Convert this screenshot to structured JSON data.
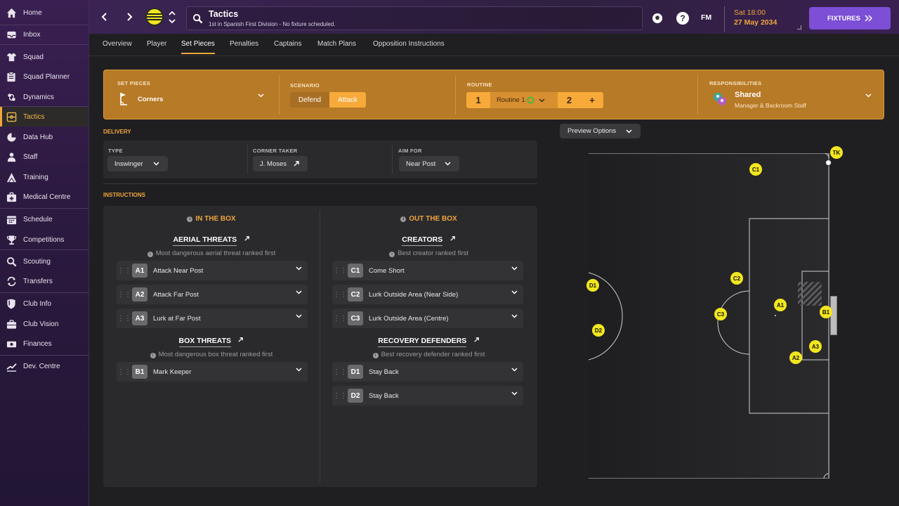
{
  "nav": {
    "items": [
      {
        "label": "Home",
        "icon": "home-icon"
      },
      {
        "label": "Inbox",
        "icon": "inbox-icon"
      },
      {
        "label": "Squad",
        "icon": "squad-icon"
      },
      {
        "label": "Squad Planner",
        "icon": "clipboard-icon"
      },
      {
        "label": "Dynamics",
        "icon": "dynamics-icon"
      },
      {
        "label": "Tactics",
        "icon": "tactics-icon"
      },
      {
        "label": "Data Hub",
        "icon": "data-hub-icon"
      },
      {
        "label": "Staff",
        "icon": "staff-icon"
      },
      {
        "label": "Training",
        "icon": "training-icon"
      },
      {
        "label": "Medical Centre",
        "icon": "medical-icon"
      },
      {
        "label": "Schedule",
        "icon": "calendar-icon"
      },
      {
        "label": "Competitions",
        "icon": "trophy-icon"
      },
      {
        "label": "Scouting",
        "icon": "search-icon"
      },
      {
        "label": "Transfers",
        "icon": "transfer-icon"
      },
      {
        "label": "Club Info",
        "icon": "shield-icon"
      },
      {
        "label": "Club Vision",
        "icon": "briefcase-icon"
      },
      {
        "label": "Finances",
        "icon": "money-icon"
      },
      {
        "label": "Dev. Centre",
        "icon": "growth-icon"
      }
    ]
  },
  "header": {
    "title": "Tactics",
    "subtitle": "1st in Spanish First Division - No fixture scheduled.",
    "date_time": "Sat 18:00",
    "date": "27 May 2034",
    "fm_label": "FM",
    "fixtures_label": "FIXTURES"
  },
  "tabs": [
    "Overview",
    "Player",
    "Set Pieces",
    "Penalties",
    "Captains",
    "Match Plans",
    "Opposition Instructions"
  ],
  "setpieces": {
    "set_pieces_label": "SET PIECES",
    "set_piece_value": "Corners",
    "scenario_label": "SCENARIO",
    "defend": "Defend",
    "attack": "Attack",
    "routine_label": "ROUTINE",
    "routine_num_1": "1",
    "routine_name": "Routine 1",
    "routine_num_2": "2",
    "routine_add": "+",
    "responsibilities_label": "RESPONSIBILITIES",
    "resp_value": "Shared",
    "resp_sub": "Manager & Backroom Staff"
  },
  "delivery": {
    "heading": "DELIVERY",
    "type_label": "TYPE",
    "type_value": "Inswinger",
    "taker_label": "CORNER TAKER",
    "taker_value": "J. Moses",
    "aim_label": "AIM FOR",
    "aim_value": "Near Post"
  },
  "instructions": {
    "heading": "INSTRUCTIONS",
    "in_box": "IN THE BOX",
    "out_box": "OUT THE BOX",
    "aerial_title": "AERIAL THREATS",
    "aerial_sub": "Most dangerous aerial threat ranked first",
    "box_title": "BOX THREATS",
    "box_sub": "Most dangerous box threat ranked first",
    "creators_title": "CREATORS",
    "creators_sub": "Best creator ranked first",
    "recovery_title": "RECOVERY DEFENDERS",
    "recovery_sub": "Best recovery defender ranked first",
    "aerial": [
      {
        "code": "A1",
        "label": "Attack Near Post"
      },
      {
        "code": "A2",
        "label": "Attack Far Post"
      },
      {
        "code": "A3",
        "label": "Lurk at Far Post"
      }
    ],
    "box": [
      {
        "code": "B1",
        "label": "Mark Keeper"
      }
    ],
    "creators": [
      {
        "code": "C1",
        "label": "Come Short"
      },
      {
        "code": "C2",
        "label": "Lurk Outside Area (Near Side)"
      },
      {
        "code": "C3",
        "label": "Lurk Outside Area (Centre)"
      }
    ],
    "recovery": [
      {
        "code": "D1",
        "label": "Stay Back"
      },
      {
        "code": "D2",
        "label": "Stay Back"
      }
    ]
  },
  "pitch": {
    "preview_label": "Preview Options",
    "markers": [
      "TK",
      "C1",
      "C2",
      "C3",
      "D1",
      "D2",
      "A1",
      "A2",
      "A3",
      "B1"
    ]
  },
  "colors": {
    "accent": "#f0a53b",
    "panel": "#b77a26",
    "marker": "#f2e61e",
    "fixtures": "#7c4fd6"
  }
}
